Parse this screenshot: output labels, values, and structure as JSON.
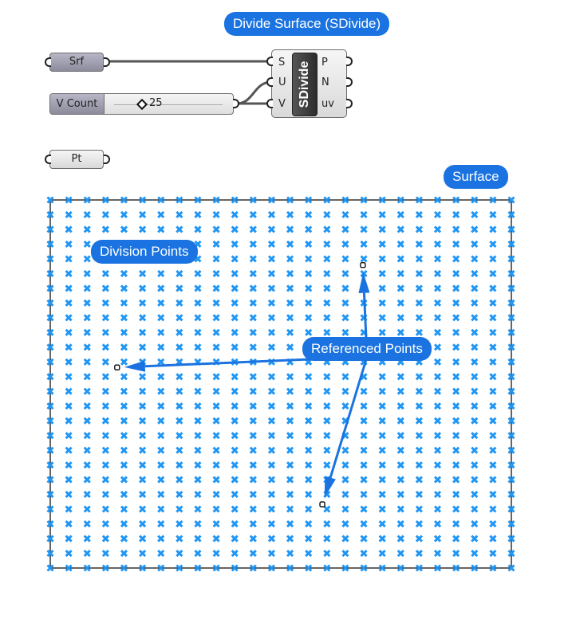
{
  "annotations": {
    "title": "Divide Surface (SDivide)",
    "surface": "Surface",
    "division_points": "Division Points",
    "referenced_points": "Referenced Points"
  },
  "components": {
    "srf_param": {
      "label": "Srf"
    },
    "slider": {
      "label": "V Count",
      "value": "25"
    },
    "pt_param": {
      "label": "Pt"
    },
    "sdivide": {
      "name": "SDivide",
      "inputs": [
        "S",
        "U",
        "V"
      ],
      "outputs": [
        "P",
        "N",
        "uv"
      ]
    }
  },
  "grid": {
    "u_count": 25,
    "v_count": 25,
    "point_color": "#2196f3",
    "border_color": "#000000"
  },
  "referenced_points": [
    {
      "u": 0.678,
      "v": 0.177
    },
    {
      "u": 0.145,
      "v": 0.455
    },
    {
      "u": 0.59,
      "v": 0.827
    }
  ],
  "colors": {
    "accent": "#1a73e0",
    "wire": "#555555"
  }
}
